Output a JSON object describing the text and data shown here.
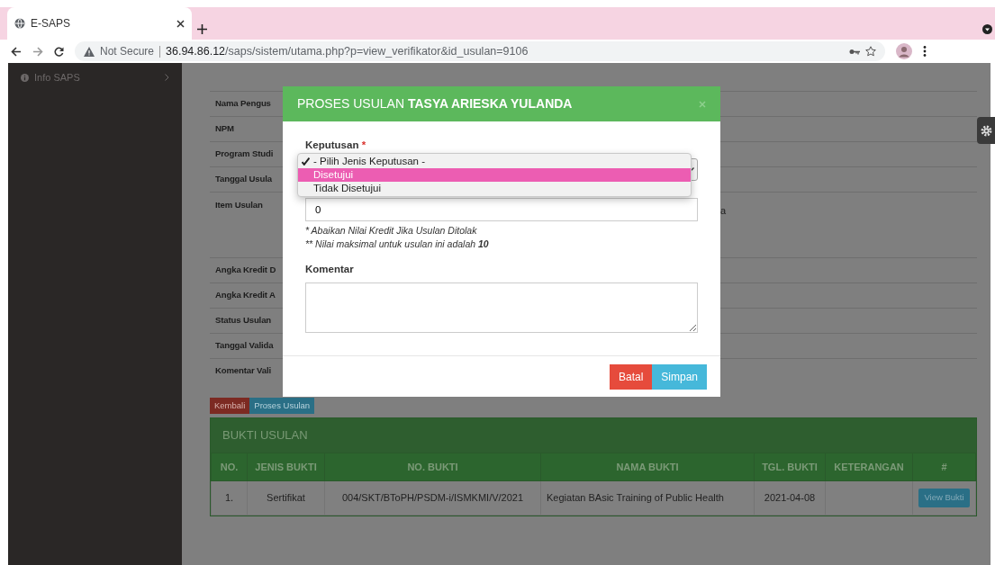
{
  "browser": {
    "tab_title": "E-SAPS",
    "security_label": "Not Secure",
    "url_host": "36.94.86.12",
    "url_path": "/saps/sistem/utama.php?p=view_verifikator&id_usulan=9106"
  },
  "sidebar": {
    "items": [
      {
        "label": "Info SAPS"
      }
    ]
  },
  "detail": {
    "rows": [
      {
        "label": "Nama Pengus"
      },
      {
        "label": "NPM"
      },
      {
        "label": "Program Studi"
      },
      {
        "label": "Tanggal Usula"
      },
      {
        "label": "Item Usulan",
        "value": "a",
        "tall": true
      },
      {
        "label": "Angka Kredit D"
      },
      {
        "label": "Angka Kredit A"
      },
      {
        "label": "Status Usulan"
      },
      {
        "label": "Tanggal Valida"
      },
      {
        "label": "Komentar Vali"
      }
    ]
  },
  "actions": [
    {
      "label": "Kembali",
      "kind": "danger"
    },
    {
      "label": "Proses Usulan",
      "kind": "info"
    }
  ],
  "bukti_table": {
    "title": "BUKTI USULAN",
    "columns": [
      "NO.",
      "JENIS BUKTI",
      "NO. BUKTI",
      "NAMA BUKTI",
      "TGL. BUKTI",
      "KETERANGAN",
      "#"
    ],
    "rows": [
      {
        "cells": [
          "1.",
          "Sertifikat",
          "004/SKT/BToPH/PSDM-i/ISMKMI/V/2021",
          "Kegiatan BAsic Training of Public Health",
          "2021-04-08",
          ""
        ],
        "action": "View Bukti"
      }
    ]
  },
  "modal": {
    "title": "PROSES USULAN",
    "title_name": "TASYA ARIESKA YULANDA",
    "decision": {
      "label": "Keputusan",
      "required_mark": "*",
      "options": [
        {
          "label": "- Pilih Jenis Keputusan -",
          "selected": true,
          "highlighted": false
        },
        {
          "label": "Disetujui",
          "selected": false,
          "highlighted": true
        },
        {
          "label": "Tidak Disetujui",
          "selected": false,
          "highlighted": false
        }
      ]
    },
    "credit": {
      "value": "0",
      "notes": [
        "* Abaikan Nilai Kredit Jika Usulan Ditolak",
        "** Nilai maksimal untuk usulan ini adalah **10**"
      ]
    },
    "comment": {
      "label": "Komentar"
    },
    "buttons": [
      {
        "label": "Batal",
        "kind": "danger"
      },
      {
        "label": "Simpan",
        "kind": "info"
      }
    ]
  }
}
